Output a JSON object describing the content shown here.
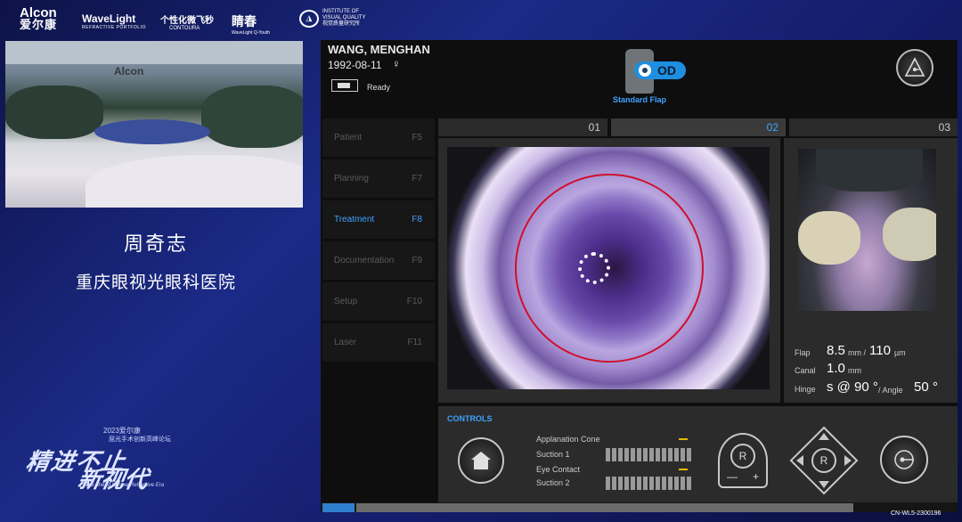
{
  "logos": {
    "alcon_en": "Alcon",
    "alcon_cn": "爱尔康",
    "wavelight": "WaveLight",
    "wavelight_sub": "REFRACTIVE PORTFOLIO",
    "contoura_cn": "个性化微飞秒",
    "contoura_en": "CONTOURA",
    "qingchun": "睛春",
    "qingchun_sub": "WaveLight Q-Youth",
    "ivq_line1": "INSTITUTE OF",
    "ivq_line2": "VISUAL QUALITY",
    "ivq_cn": "视觉质量研究所"
  },
  "camera": {
    "brand": "Alcon"
  },
  "speaker": {
    "name": "周奇志",
    "organization": "重庆眼视光眼科医院"
  },
  "event": {
    "year": "2023爱尔康",
    "forum": "屈光手术创新高峰论坛",
    "title_1": "精进不止",
    "title_2": "新视代",
    "subtitle_en": "Forge ahead to New Refractive Era"
  },
  "laser_ui": {
    "patient_name": "WANG, MENGHAN",
    "patient_dob": "1992-08-11",
    "patient_sex_symbol": "♀",
    "device_status": "Ready",
    "eye": "OD",
    "flap_mode": "Standard Flap",
    "nav": [
      {
        "label": "Patient",
        "key": "F5",
        "active": false
      },
      {
        "label": "Planning",
        "key": "F7",
        "active": false
      },
      {
        "label": "Treatment",
        "key": "F8",
        "active": true
      },
      {
        "label": "Documentation",
        "key": "F9",
        "active": false
      },
      {
        "label": "Setup",
        "key": "F10",
        "active": false
      },
      {
        "label": "Laser",
        "key": "F11",
        "active": false
      }
    ],
    "steps": [
      "01",
      "02",
      "03"
    ],
    "active_step": "02",
    "params": {
      "flap_label": "Flap",
      "flap_diameter": "8.5",
      "flap_diameter_unit": "mm /",
      "flap_thickness": "110",
      "flap_thickness_unit": "µm",
      "canal_label": "Canal",
      "canal_value": "1.0",
      "canal_unit": "mm",
      "hinge_label": "Hinge",
      "hinge_value": "s @ 90 °",
      "angle_label": "/ Angle",
      "angle_value": "50 °"
    },
    "controls": {
      "title": "CONTROLS",
      "applanation_cone": "Applanation Cone",
      "suction_1": "Suction 1",
      "eye_contact": "Eye Contact",
      "suction_2": "Suction 2",
      "r_label": "R",
      "minus": "—",
      "plus": "+"
    },
    "accent_color": "#3ea2ff",
    "ring_color": "#d0102a"
  },
  "footer": {
    "code": "CN-WL5-2300196"
  }
}
